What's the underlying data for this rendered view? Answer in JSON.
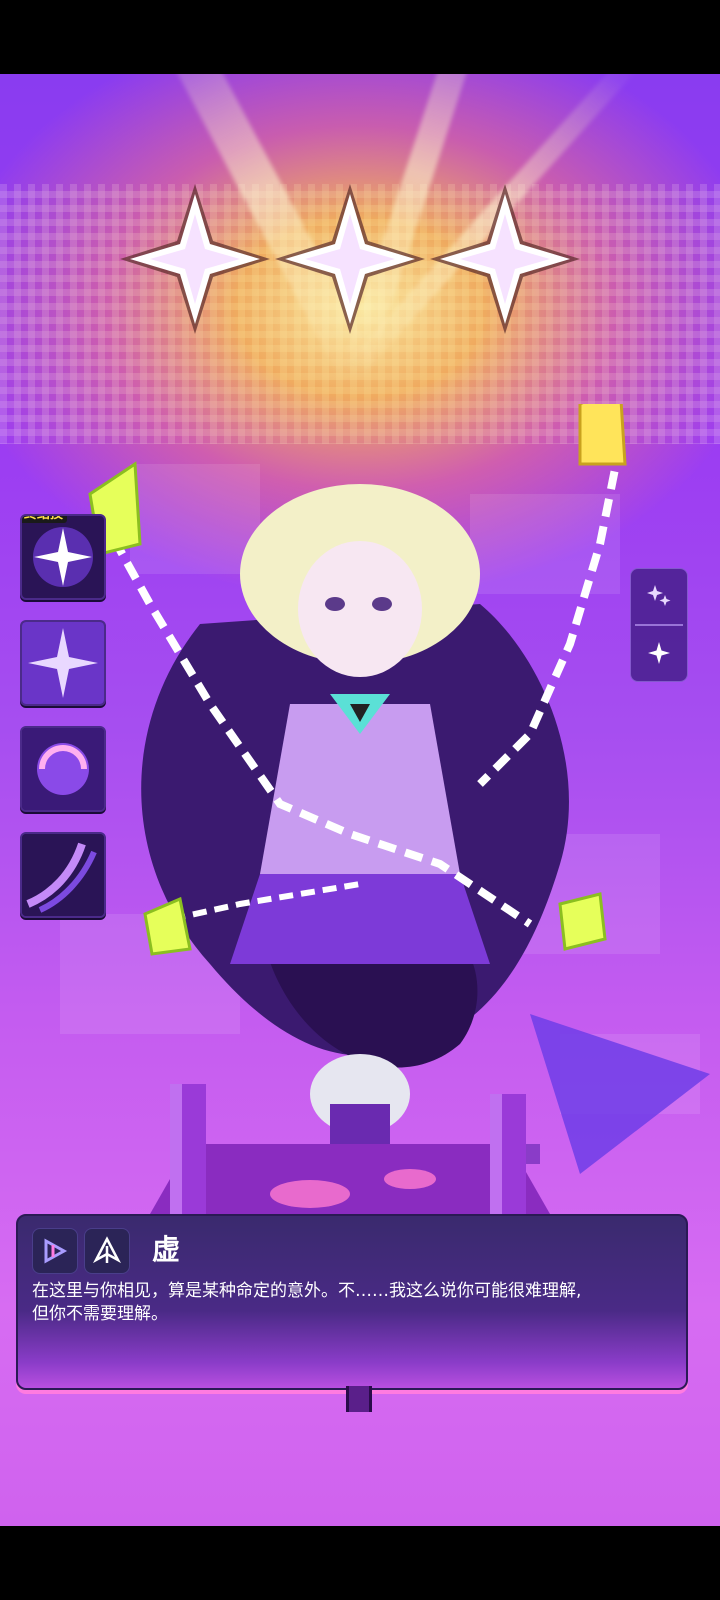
{
  "scene": {
    "star_count": 3,
    "colors": {
      "background_top": "#8a3cf0",
      "background_bottom": "#d76cf2",
      "glow": "#ffe08a",
      "accent_green": "#e6ff5a",
      "dialog_bg": "#3a2a6e"
    }
  },
  "skills": [
    {
      "tag": "终结技",
      "icon": "burst-spark-icon"
    },
    {
      "tag": "",
      "icon": "cross-flare-icon"
    },
    {
      "tag": "",
      "icon": "swirl-orb-icon"
    },
    {
      "tag": "",
      "icon": "wave-arc-icon"
    }
  ],
  "side_panel": {
    "top_icon": "double-sparkle-icon",
    "bottom_icon": "single-sparkle-icon"
  },
  "dialog": {
    "faction_icon": "faction-emblem-icon",
    "class_icon": "arrow-class-icon",
    "speaker": "虚",
    "line1": "在这里与你相见，算是某种命定的意外。不……我这么说你可能很难理解,",
    "line2": "但你不需要理解。"
  }
}
